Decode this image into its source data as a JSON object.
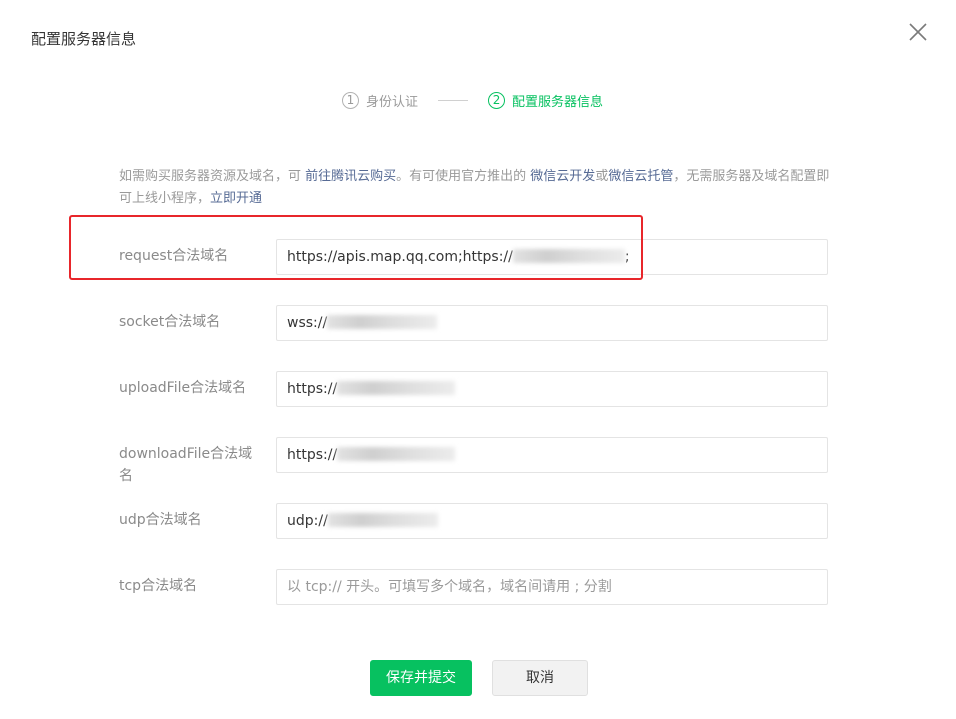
{
  "dialog": {
    "title": "配置服务器信息"
  },
  "steps": [
    {
      "number": "1",
      "label": "身份认证",
      "state": "done"
    },
    {
      "number": "2",
      "label": "配置服务器信息",
      "state": "active"
    }
  ],
  "intro": {
    "text_1": "如需购买服务器资源及域名，可 ",
    "link_buy": "前往腾讯云购买",
    "text_2": "。有可使用官方推出的 ",
    "link_cloud_dev": "微信云开发",
    "text_3": "或",
    "link_cloud_host": "微信云托管",
    "text_4": "，无需服务器及域名配置即可上线小程序，",
    "link_open": "立即开通"
  },
  "form": {
    "request": {
      "label": "request合法域名",
      "value_prefix": "https://apis.map.qq.com;https://",
      "value_suffix": ";"
    },
    "socket": {
      "label": "socket合法域名",
      "value_prefix": "wss://"
    },
    "uploadFile": {
      "label": "uploadFile合法域名",
      "value_prefix": "https://"
    },
    "downloadFile": {
      "label": "downloadFile合法域名",
      "value_prefix": "https://"
    },
    "udp": {
      "label": "udp合法域名",
      "value_prefix": "udp://"
    },
    "tcp": {
      "label": "tcp合法域名",
      "placeholder": "以 tcp:// 开头。可填写多个域名，域名间请用 ; 分割"
    }
  },
  "buttons": {
    "submit": "保存并提交",
    "cancel": "取消"
  },
  "colors": {
    "accent": "#07c160",
    "link": "#576b95",
    "highlight": "#e8262b"
  },
  "icons": {
    "close": "close-icon"
  }
}
